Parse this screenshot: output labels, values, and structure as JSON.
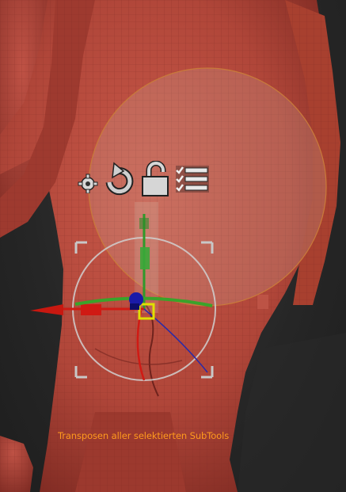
{
  "viewport": {
    "background": "#2d2d2d",
    "model_color": "#b24a3e",
    "status_message": "Transposen aller selektierten SubTools",
    "status_color": "#ff9a1e"
  },
  "transpose_toolbar": {
    "buttons": [
      {
        "icon": "gear-icon"
      },
      {
        "icon": "rotate-icon"
      },
      {
        "icon": "unlock-icon"
      },
      {
        "icon": "checklist-icon"
      }
    ]
  },
  "gizmo": {
    "axis_colors": {
      "x": "#d01a14",
      "y": "#2f9a2a",
      "z": "#1a1aa8",
      "center": "#e0e000"
    }
  }
}
